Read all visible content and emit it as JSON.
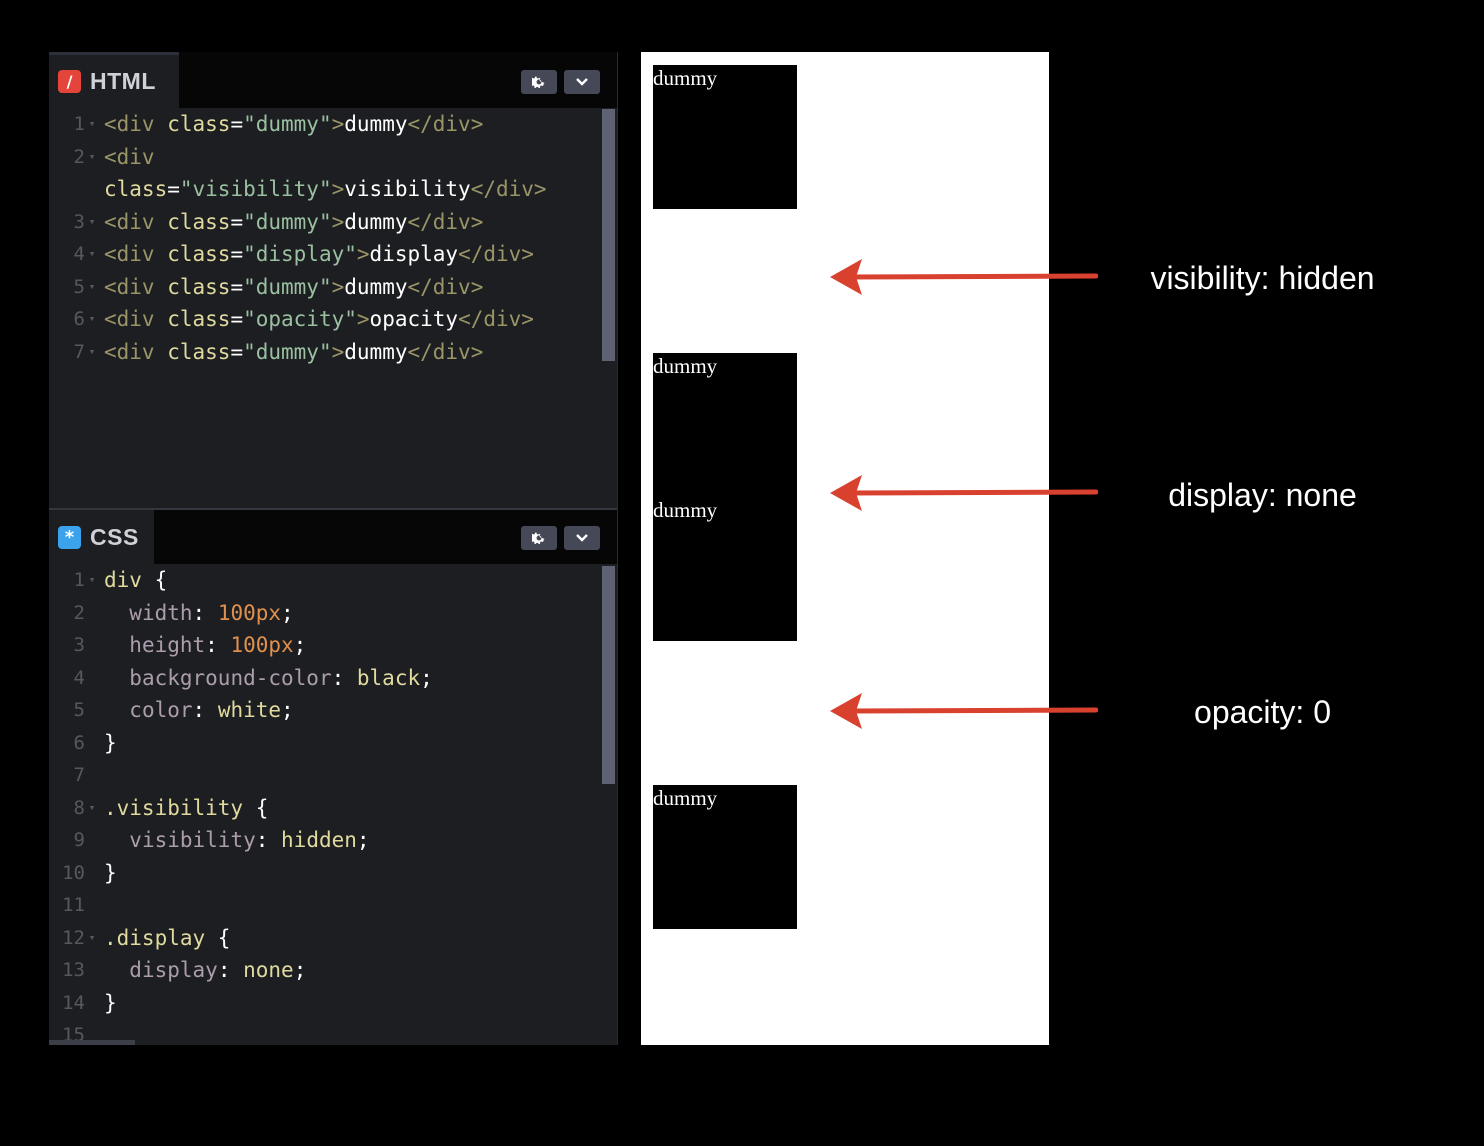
{
  "html_pane": {
    "tab_label": "HTML",
    "tab_icon": "slash-icon",
    "icon_glyph": "/",
    "lines": [
      {
        "n": "1",
        "tokens": [
          [
            "tag",
            "<div "
          ],
          [
            "attr",
            "class"
          ],
          [
            "plain",
            "="
          ],
          [
            "val",
            "\"dummy\""
          ],
          [
            "tag",
            ">"
          ],
          [
            "plain",
            "dummy"
          ],
          [
            "tag",
            "</div>"
          ]
        ]
      },
      {
        "n": "2",
        "tokens": [
          [
            "tag",
            "<div"
          ]
        ]
      },
      {
        "n": "",
        "tokens": [
          [
            "attr",
            "class"
          ],
          [
            "plain",
            "="
          ],
          [
            "val",
            "\"visibility\""
          ],
          [
            "tag",
            ">"
          ],
          [
            "plain",
            "visibility"
          ],
          [
            "tag",
            "</div>"
          ]
        ]
      },
      {
        "n": "3",
        "tokens": [
          [
            "tag",
            "<div "
          ],
          [
            "attr",
            "class"
          ],
          [
            "plain",
            "="
          ],
          [
            "val",
            "\"dummy\""
          ],
          [
            "tag",
            ">"
          ],
          [
            "plain",
            "dummy"
          ],
          [
            "tag",
            "</div>"
          ]
        ]
      },
      {
        "n": "4",
        "tokens": [
          [
            "tag",
            "<div "
          ],
          [
            "attr",
            "class"
          ],
          [
            "plain",
            "="
          ],
          [
            "val",
            "\"display\""
          ],
          [
            "tag",
            ">"
          ],
          [
            "plain",
            "display"
          ],
          [
            "tag",
            "</div>"
          ]
        ]
      },
      {
        "n": "5",
        "tokens": [
          [
            "tag",
            "<div "
          ],
          [
            "attr",
            "class"
          ],
          [
            "plain",
            "="
          ],
          [
            "val",
            "\"dummy\""
          ],
          [
            "tag",
            ">"
          ],
          [
            "plain",
            "dummy"
          ],
          [
            "tag",
            "</div>"
          ]
        ]
      },
      {
        "n": "6",
        "tokens": [
          [
            "tag",
            "<div "
          ],
          [
            "attr",
            "class"
          ],
          [
            "plain",
            "="
          ],
          [
            "val",
            "\"opacity\""
          ],
          [
            "tag",
            ">"
          ],
          [
            "plain",
            "opacity"
          ],
          [
            "tag",
            "</div>"
          ]
        ]
      },
      {
        "n": "7",
        "tokens": [
          [
            "tag",
            "<div "
          ],
          [
            "attr",
            "class"
          ],
          [
            "plain",
            "="
          ],
          [
            "val",
            "\"dummy\""
          ],
          [
            "tag",
            ">"
          ],
          [
            "plain",
            "dummy"
          ],
          [
            "tag",
            "</div>"
          ]
        ]
      }
    ]
  },
  "css_pane": {
    "tab_label": "CSS",
    "tab_icon": "asterisk-icon",
    "icon_glyph": "*",
    "lines": [
      {
        "n": "1",
        "fold": true,
        "tokens": [
          [
            "sel",
            "div"
          ],
          [
            "plain",
            " {"
          ]
        ]
      },
      {
        "n": "2",
        "tokens": [
          [
            "plain",
            "  "
          ],
          [
            "prop",
            "width"
          ],
          [
            "plain",
            ": "
          ],
          [
            "num",
            "100px"
          ],
          [
            "plain",
            ";"
          ]
        ]
      },
      {
        "n": "3",
        "tokens": [
          [
            "plain",
            "  "
          ],
          [
            "prop",
            "height"
          ],
          [
            "plain",
            ": "
          ],
          [
            "num",
            "100px"
          ],
          [
            "plain",
            ";"
          ]
        ]
      },
      {
        "n": "4",
        "tokens": [
          [
            "plain",
            "  "
          ],
          [
            "prop",
            "background-color"
          ],
          [
            "plain",
            ": "
          ],
          [
            "kw",
            "black"
          ],
          [
            "plain",
            ";"
          ]
        ]
      },
      {
        "n": "5",
        "tokens": [
          [
            "plain",
            "  "
          ],
          [
            "prop",
            "color"
          ],
          [
            "plain",
            ": "
          ],
          [
            "kw",
            "white"
          ],
          [
            "plain",
            ";"
          ]
        ]
      },
      {
        "n": "6",
        "tokens": [
          [
            "plain",
            "}"
          ]
        ]
      },
      {
        "n": "7",
        "tokens": []
      },
      {
        "n": "8",
        "fold": true,
        "tokens": [
          [
            "sel",
            ".visibility"
          ],
          [
            "plain",
            " {"
          ]
        ]
      },
      {
        "n": "9",
        "tokens": [
          [
            "plain",
            "  "
          ],
          [
            "prop",
            "visibility"
          ],
          [
            "plain",
            ": "
          ],
          [
            "kw",
            "hidden"
          ],
          [
            "plain",
            ";"
          ]
        ]
      },
      {
        "n": "10",
        "tokens": [
          [
            "plain",
            "}"
          ]
        ]
      },
      {
        "n": "11",
        "tokens": []
      },
      {
        "n": "12",
        "fold": true,
        "tokens": [
          [
            "sel",
            ".display"
          ],
          [
            "plain",
            " {"
          ]
        ]
      },
      {
        "n": "13",
        "tokens": [
          [
            "plain",
            "  "
          ],
          [
            "prop",
            "display"
          ],
          [
            "plain",
            ": "
          ],
          [
            "kw",
            "none"
          ],
          [
            "plain",
            ";"
          ]
        ]
      },
      {
        "n": "14",
        "tokens": [
          [
            "plain",
            "}"
          ]
        ]
      },
      {
        "n": "15",
        "tokens": []
      }
    ]
  },
  "header_buttons": {
    "settings_icon": "gear-icon",
    "collapse_icon": "chevron-down-icon"
  },
  "preview": {
    "box_labels": [
      "dummy",
      "dummy",
      "dummy",
      "dummy"
    ]
  },
  "annotations": {
    "visibility": "visibility: hidden",
    "display": "display: none",
    "opacity": "opacity: 0",
    "arrow_color": "#d9412f"
  }
}
